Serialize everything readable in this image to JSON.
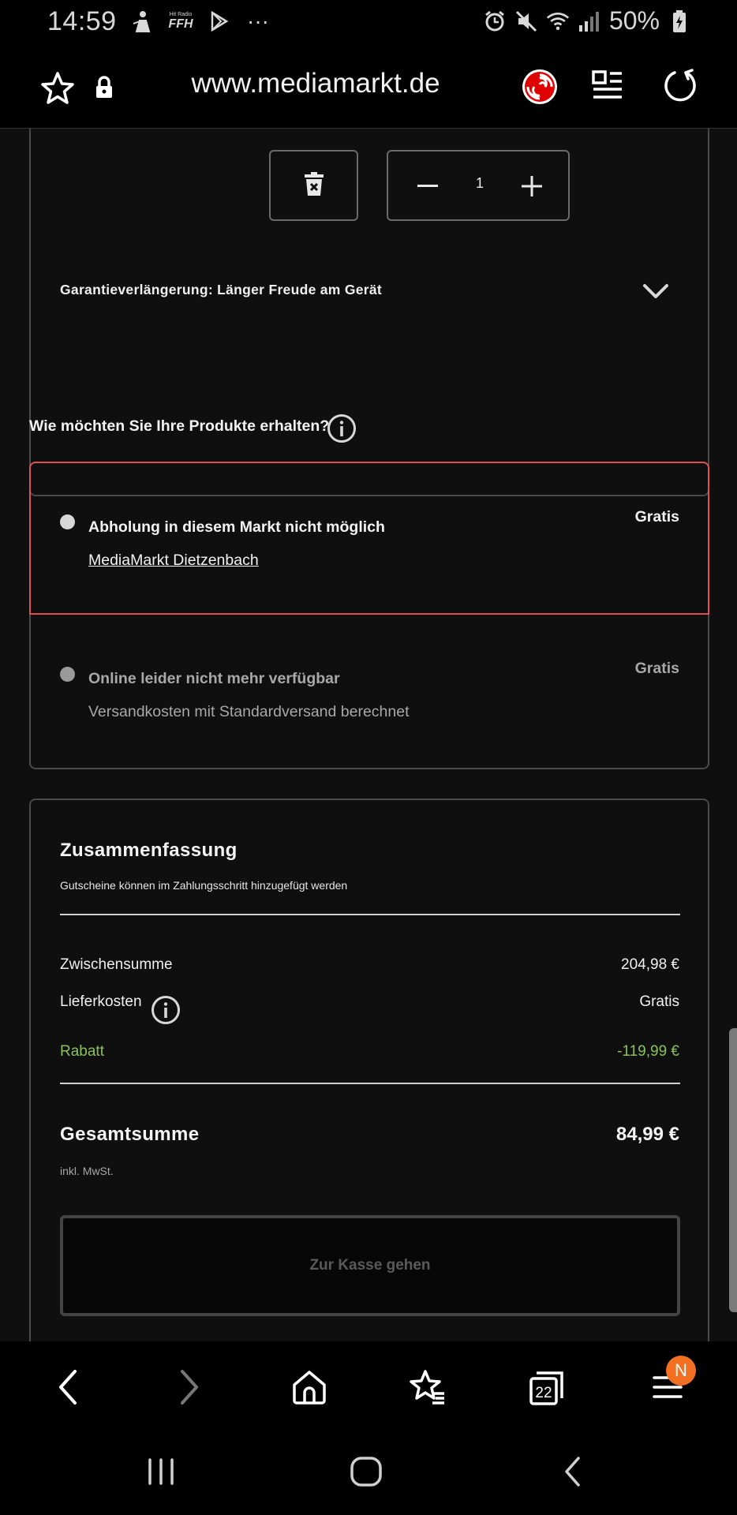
{
  "status_bar": {
    "time": "14:59",
    "battery": "50%",
    "icons": [
      "person-icon",
      "ffh-icon",
      "play-store-icon",
      "more-dots-icon",
      "alarm-icon",
      "mute-icon",
      "wifi-icon",
      "signal-icon",
      "battery-icon"
    ],
    "ffh_label": "FFH",
    "ffh_sub": "Hit Radio",
    "dots": "···"
  },
  "toolbar": {
    "url": "www.mediamarkt.de",
    "icons": [
      "bookmark-star-icon",
      "lock-icon",
      "mediamarkt-logo",
      "reader-mode-icon",
      "reload-icon"
    ]
  },
  "cart_item": {
    "quantity": "1",
    "warranty_label": "Garantieverlängerung: Länger Freude am Gerät"
  },
  "delivery": {
    "question": "Wie möchten Sie Ihre Produkte erhalten?",
    "options": [
      {
        "title": "Abholung in diesem Markt nicht möglich",
        "subtitle": "MediaMarkt Dietzenbach",
        "price": "Gratis",
        "selected": true
      },
      {
        "title": "Online leider nicht mehr verfügbar",
        "subtitle": "Versandkosten mit Standardversand berechnet",
        "price": "Gratis",
        "selected": false
      }
    ]
  },
  "summary": {
    "title": "Zusammenfassung",
    "note": "Gutscheine können im Zahlungsschritt hinzugefügt werden",
    "subtotal_label": "Zwischensumme",
    "subtotal_value": "204,98 €",
    "delivery_label": "Lieferkosten",
    "delivery_value": "Gratis",
    "discount_label": "Rabatt",
    "discount_value": "-119,99 €",
    "total_label": "Gesamtsumme",
    "total_value": "84,99 €",
    "vat_note": "inkl. MwSt.",
    "checkout_label": "Zur Kasse gehen"
  },
  "browser_nav": {
    "tabs_count": "22",
    "notification_badge": "N"
  },
  "colors": {
    "selected_border": "#e05050",
    "discount_green": "#8ac25a",
    "badge_orange": "#f36f21",
    "brand_red": "#df0000"
  }
}
